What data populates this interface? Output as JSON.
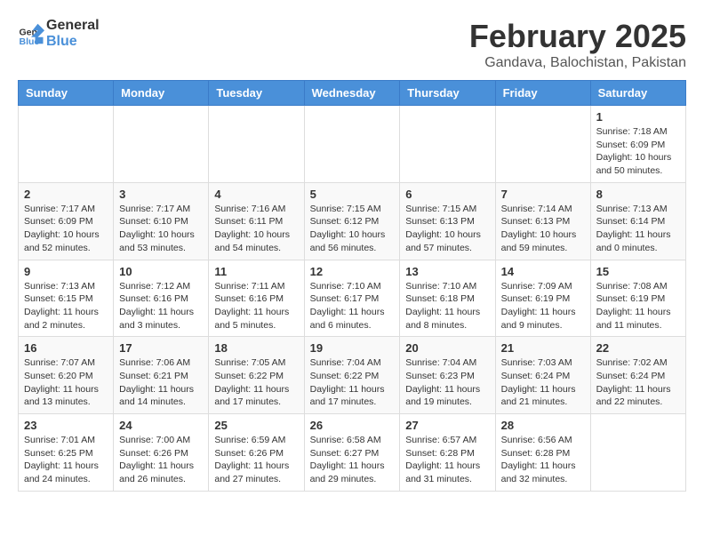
{
  "logo": {
    "general": "General",
    "blue": "Blue"
  },
  "title": "February 2025",
  "location": "Gandava, Balochistan, Pakistan",
  "days_of_week": [
    "Sunday",
    "Monday",
    "Tuesday",
    "Wednesday",
    "Thursday",
    "Friday",
    "Saturday"
  ],
  "weeks": [
    [
      {
        "day": "",
        "info": ""
      },
      {
        "day": "",
        "info": ""
      },
      {
        "day": "",
        "info": ""
      },
      {
        "day": "",
        "info": ""
      },
      {
        "day": "",
        "info": ""
      },
      {
        "day": "",
        "info": ""
      },
      {
        "day": "1",
        "info": "Sunrise: 7:18 AM\nSunset: 6:09 PM\nDaylight: 10 hours and 50 minutes."
      }
    ],
    [
      {
        "day": "2",
        "info": "Sunrise: 7:17 AM\nSunset: 6:09 PM\nDaylight: 10 hours and 52 minutes."
      },
      {
        "day": "3",
        "info": "Sunrise: 7:17 AM\nSunset: 6:10 PM\nDaylight: 10 hours and 53 minutes."
      },
      {
        "day": "4",
        "info": "Sunrise: 7:16 AM\nSunset: 6:11 PM\nDaylight: 10 hours and 54 minutes."
      },
      {
        "day": "5",
        "info": "Sunrise: 7:15 AM\nSunset: 6:12 PM\nDaylight: 10 hours and 56 minutes."
      },
      {
        "day": "6",
        "info": "Sunrise: 7:15 AM\nSunset: 6:13 PM\nDaylight: 10 hours and 57 minutes."
      },
      {
        "day": "7",
        "info": "Sunrise: 7:14 AM\nSunset: 6:13 PM\nDaylight: 10 hours and 59 minutes."
      },
      {
        "day": "8",
        "info": "Sunrise: 7:13 AM\nSunset: 6:14 PM\nDaylight: 11 hours and 0 minutes."
      }
    ],
    [
      {
        "day": "9",
        "info": "Sunrise: 7:13 AM\nSunset: 6:15 PM\nDaylight: 11 hours and 2 minutes."
      },
      {
        "day": "10",
        "info": "Sunrise: 7:12 AM\nSunset: 6:16 PM\nDaylight: 11 hours and 3 minutes."
      },
      {
        "day": "11",
        "info": "Sunrise: 7:11 AM\nSunset: 6:16 PM\nDaylight: 11 hours and 5 minutes."
      },
      {
        "day": "12",
        "info": "Sunrise: 7:10 AM\nSunset: 6:17 PM\nDaylight: 11 hours and 6 minutes."
      },
      {
        "day": "13",
        "info": "Sunrise: 7:10 AM\nSunset: 6:18 PM\nDaylight: 11 hours and 8 minutes."
      },
      {
        "day": "14",
        "info": "Sunrise: 7:09 AM\nSunset: 6:19 PM\nDaylight: 11 hours and 9 minutes."
      },
      {
        "day": "15",
        "info": "Sunrise: 7:08 AM\nSunset: 6:19 PM\nDaylight: 11 hours and 11 minutes."
      }
    ],
    [
      {
        "day": "16",
        "info": "Sunrise: 7:07 AM\nSunset: 6:20 PM\nDaylight: 11 hours and 13 minutes."
      },
      {
        "day": "17",
        "info": "Sunrise: 7:06 AM\nSunset: 6:21 PM\nDaylight: 11 hours and 14 minutes."
      },
      {
        "day": "18",
        "info": "Sunrise: 7:05 AM\nSunset: 6:22 PM\nDaylight: 11 hours and 17 minutes."
      },
      {
        "day": "19",
        "info": "Sunrise: 7:04 AM\nSunset: 6:22 PM\nDaylight: 11 hours and 17 minutes."
      },
      {
        "day": "20",
        "info": "Sunrise: 7:04 AM\nSunset: 6:23 PM\nDaylight: 11 hours and 19 minutes."
      },
      {
        "day": "21",
        "info": "Sunrise: 7:03 AM\nSunset: 6:24 PM\nDaylight: 11 hours and 21 minutes."
      },
      {
        "day": "22",
        "info": "Sunrise: 7:02 AM\nSunset: 6:24 PM\nDaylight: 11 hours and 22 minutes."
      }
    ],
    [
      {
        "day": "23",
        "info": "Sunrise: 7:01 AM\nSunset: 6:25 PM\nDaylight: 11 hours and 24 minutes."
      },
      {
        "day": "24",
        "info": "Sunrise: 7:00 AM\nSunset: 6:26 PM\nDaylight: 11 hours and 26 minutes."
      },
      {
        "day": "25",
        "info": "Sunrise: 6:59 AM\nSunset: 6:26 PM\nDaylight: 11 hours and 27 minutes."
      },
      {
        "day": "26",
        "info": "Sunrise: 6:58 AM\nSunset: 6:27 PM\nDaylight: 11 hours and 29 minutes."
      },
      {
        "day": "27",
        "info": "Sunrise: 6:57 AM\nSunset: 6:28 PM\nDaylight: 11 hours and 31 minutes."
      },
      {
        "day": "28",
        "info": "Sunrise: 6:56 AM\nSunset: 6:28 PM\nDaylight: 11 hours and 32 minutes."
      },
      {
        "day": "",
        "info": ""
      }
    ]
  ]
}
